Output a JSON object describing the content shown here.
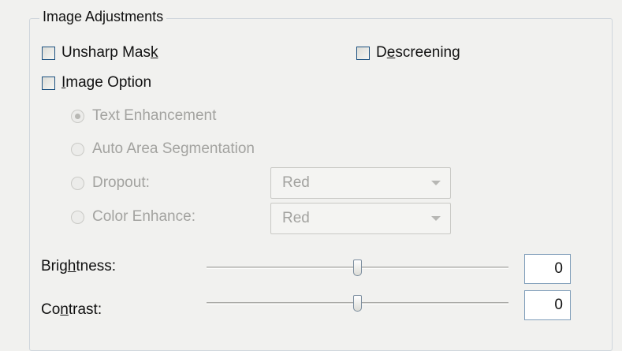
{
  "group": {
    "title": "Image Adjustments"
  },
  "checkboxes": {
    "unsharp_mask": {
      "label_pre": "Unsharp Mas",
      "label_u": "k",
      "label_post": "",
      "checked": false
    },
    "descreening": {
      "label_pre": "D",
      "label_u": "e",
      "label_post": "screening",
      "checked": false
    },
    "image_option": {
      "label_pre": "",
      "label_u": "I",
      "label_post": "mage Option",
      "checked": false
    }
  },
  "radios": {
    "text_enhancement": {
      "label": "Text Enhancement",
      "selected": true
    },
    "auto_area_segmentation": {
      "label": "Auto Area Segmentation",
      "selected": false
    },
    "dropout": {
      "label": "Dropout:",
      "selected": false
    },
    "color_enhance": {
      "label": "Color Enhance:",
      "selected": false
    }
  },
  "dropdowns": {
    "dropout_value": "Red",
    "color_enhance_value": "Red"
  },
  "sliders": {
    "brightness": {
      "label_pre": "Brig",
      "label_u": "h",
      "label_post": "tness:",
      "value": "0"
    },
    "contrast": {
      "label_pre": "Co",
      "label_u": "n",
      "label_post": "trast:",
      "value": "0"
    }
  }
}
